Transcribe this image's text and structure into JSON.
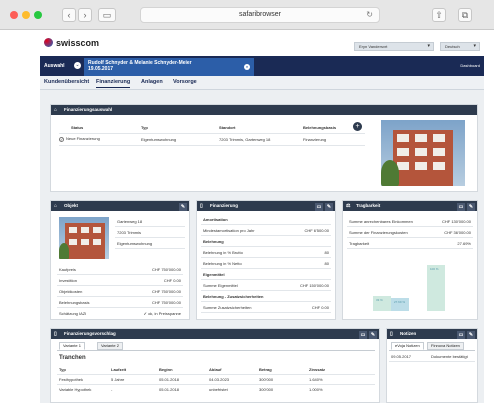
{
  "browser": {
    "url": "safaribrowser",
    "back_icon": "chevron-left-icon",
    "forward_icon": "chevron-right-icon"
  },
  "app": {
    "brand": "swisscom",
    "user_select": "Eryn Vandersvrt",
    "lang_select": "Deutsch"
  },
  "clientbar": {
    "auswahl": "Auswahl",
    "client_name": "Rudolf Schnyder & Melanie Schnyder-Meier",
    "client_date": "19.05.2017",
    "dashboard": "Dashboard"
  },
  "nav": {
    "tabs": [
      "Kundenübersicht",
      "Finanzierung",
      "Anlagen",
      "Vorsorge"
    ],
    "active": "Finanzierung"
  },
  "finanzierungsauswahl": {
    "title": "Finanzierungsauswahl",
    "headers": [
      "Status",
      "Typ",
      "Standort",
      "Belehnungsbasis"
    ],
    "row": [
      "Neue Finanzierung",
      "Eigentumswohnung",
      "7203 Trimmis, Gartenweg 18",
      "Finanzierung"
    ]
  },
  "objekt": {
    "title": "Objekt",
    "address_lines": [
      "Gartenweg 18",
      "7203 Trimmis",
      "Eigentumswohnung"
    ],
    "rows": [
      {
        "label": "Kaufpreis",
        "value": "CHF 750'000.00"
      },
      {
        "label": "Investition",
        "value": "CHF 0.00"
      },
      {
        "label": "Objektkosten",
        "value": "CHF 750'000.00"
      },
      {
        "label": "Belehnungsbasis",
        "value": "CHF 750'000.00"
      },
      {
        "label": "Schätzung IAZI",
        "value": "ok, in Preisspanne"
      }
    ]
  },
  "finanzierung": {
    "title": "Finanzierung",
    "rows": [
      {
        "label": "Amortisation",
        "value": "",
        "bold": true
      },
      {
        "label": "Mindestamortisation pro Jahr",
        "value": "CHF 6'500.00",
        "bold": false
      },
      {
        "label": "Belehnung",
        "value": "",
        "bold": true
      },
      {
        "label": "Belehnung in % Brutto",
        "value": "80",
        "bold": false
      },
      {
        "label": "Belehnung in % Netto",
        "value": "80",
        "bold": false
      },
      {
        "label": "Eigenmittel",
        "value": "",
        "bold": true
      },
      {
        "label": "Summe Eigenmittel",
        "value": "CHF 150'000.00",
        "bold": false
      },
      {
        "label": "Belehnung - Zusatzsicherheiten",
        "value": "",
        "bold": true
      },
      {
        "label": "Summe Zusatzsicherheiten",
        "value": "CHF 0.00",
        "bold": false
      }
    ]
  },
  "tragbarkeit": {
    "title": "Tragbarkeit",
    "rows": [
      {
        "label": "Summe anrechenbares Einkommen",
        "value": "CHF 130'000.00"
      },
      {
        "label": "Summe der Finanzierungskosten",
        "value": "CHF 36'000.00"
      },
      {
        "label": "Tragbarkeit",
        "value": "27.69%"
      }
    ],
    "chart": {
      "labels": [
        "33 %",
        "27.69 %",
        "100 %"
      ],
      "values": [
        33,
        27.69,
        100
      ]
    }
  },
  "finanzierungsvorschlag": {
    "title": "Finanzierungsvorschlag",
    "tabs": [
      "Variante 1",
      "Variante 2"
    ],
    "section": "Tranchen",
    "headers": [
      "Typ",
      "Laufzeit",
      "Beginn",
      "Ablauf",
      "Betrag",
      "Zinssatz"
    ],
    "rows": [
      [
        "Festhypothek",
        "5 Jahre",
        "05.01.2018",
        "04.03.2023",
        "300'000",
        "1.640%"
      ],
      [
        "Variable Hypothek",
        "-",
        "05.01.2018",
        "unbefristet",
        "300'000",
        "1.000%"
      ]
    ]
  },
  "notizen": {
    "title": "Notizen",
    "tabs": [
      "eVoja Notizen",
      "Finnova Notizen"
    ],
    "entries": [
      {
        "date": "09.05.2017",
        "text": "Dokumente bestätigt"
      }
    ]
  },
  "colors": {
    "navy": "#1a2a55",
    "panel_header": "#2e3b4e",
    "accent_blue": "#2c5ea8"
  }
}
